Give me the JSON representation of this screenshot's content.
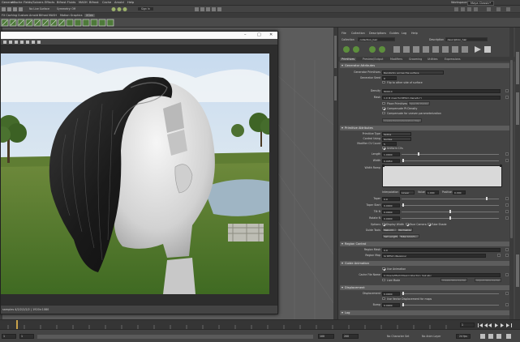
{
  "menubar": {
    "items": [
      "Generate",
      "nCache",
      "Fields/Solvers",
      "Effects",
      "Bifrost Fluids",
      "MASH",
      "Bifrost",
      "Cache",
      "Arnold",
      "Help"
    ],
    "workspace_label": "Workspace:",
    "workspace_value": "Maya Classic*"
  },
  "statusline": {
    "mode": "No Live Surface",
    "symmetry": "Symmetry: Off",
    "signin": "Sign In"
  },
  "shelf": {
    "tabs": [
      "FX Caching",
      "Custom",
      "Arnold",
      "Bifrost",
      "MASH",
      "Motion Graphics",
      "XGen"
    ],
    "active_tab": "XGen"
  },
  "render_window": {
    "footer_text": "samples 4/2/2/2/2/2 | 1920×1080"
  },
  "attribute_editor": {
    "menu": [
      "File",
      "Collection",
      "Descriptions",
      "Guides",
      "Log",
      "Help"
    ],
    "collection_label": "Collection",
    "collection_value": "collection_hair",
    "description_label": "Description",
    "description_value": "description_hair",
    "tabs": [
      "Primitives",
      "Preview/Output",
      "Modifiers",
      "Grooming",
      "Utilities",
      "Expressions"
    ],
    "active_tab": "Primitives",
    "sections": {
      "generator": "Generator Attributes",
      "primitive": "Primitive Attributes",
      "region": "Region Control",
      "guide_anim": "Guide Animation",
      "displacement": "Displacement",
      "log": "Log"
    },
    "generator": {
      "generator_label": "Generator Primitives",
      "generator_value": "Randomly across the surface",
      "seed_label": "Generator Seed",
      "seed_value": "0",
      "flip_label": "Flip to other side of surface",
      "density_label": "Density",
      "density_value": "8000.0",
      "mask_label": "Mask",
      "mask_value": "1.0 # map('${DESC}/density/')",
      "use_points_label": "Place Primitives at",
      "points_value": "Specific Points",
      "comp_pt_label": "Compensate Pt Density",
      "comp_uv_label": "Compensate for uneven parameterization",
      "create_map_label": "Create Parameterization Map"
    },
    "primitive": {
      "prim_type_label": "Primitive Type",
      "prim_type_value": "Spline",
      "control_using_label": "Control Using",
      "control_using_value": "Guides",
      "modifier_cv_label": "Modifier CV Count",
      "modifier_cv_value": "5",
      "uniform_cv_label": "Uniform CVs",
      "length_label": "Length",
      "length_value": "1.0000",
      "width_label": "Width",
      "width_value": "0.0050",
      "width_ramp_label": "Width Ramp",
      "interp_label": "Interpolation",
      "interp_value": "Linear",
      "ramp_value_label": "Value",
      "ramp_value": "1.000",
      "ramp_pos_label": "Position",
      "ramp_pos": "0.000",
      "taper_label": "Taper",
      "taper_value": "0.0",
      "taper_start_label": "Taper Start",
      "taper_start_value": "0.0000",
      "tilt_u_label": "Tilt N",
      "tilt_u_value": "0.0000",
      "tilt_v_label": "Rotate N",
      "tilt_v_value": "0.0000",
      "options_label": "Options",
      "display_width_label": "Display Width",
      "face_camera_label": "Face Camera",
      "tube_shade_label": "Tube Shade",
      "guide_tools_label": "Guide Tools",
      "rebuild_btn": "Rebuild...",
      "normalize_btn": "Normalize",
      "set_length_btn": "Set Length...",
      "tube_groom_btn": "Tube Groom..."
    },
    "region": {
      "region_mask_label": "Region Mask",
      "region_mask_value": "0.0",
      "region_map_label": "Region Map",
      "region_map_value": "${DESC}/Regions/"
    },
    "guide_anim": {
      "use_anim_label": "Use Animation",
      "cache_file_label": "Cache File Name",
      "cache_file_value": "C:/Users/Mark/XGen/collection_hair.abc",
      "live_mode_label": "Live Mode",
      "create_cache_btn": "Create Wire Cache",
      "import_btn": "Import Wire Cache"
    },
    "displacement": {
      "disp_label": "Displacement",
      "disp_value": "0.0000",
      "use_disp_label": "Use Vector Displacement for maps",
      "bump_label": "Bump",
      "bump_value": "0.0000"
    }
  },
  "rangebar": {
    "start": "1",
    "range_start": "100",
    "range_end": "200",
    "end": "200",
    "character_set": "No Character Set",
    "anim_layer": "No Anim Layer",
    "fps": "24 fps"
  },
  "colors": {
    "accent_green": "#6a9a4a",
    "panel": "#444444",
    "field": "#2b2b2b"
  }
}
